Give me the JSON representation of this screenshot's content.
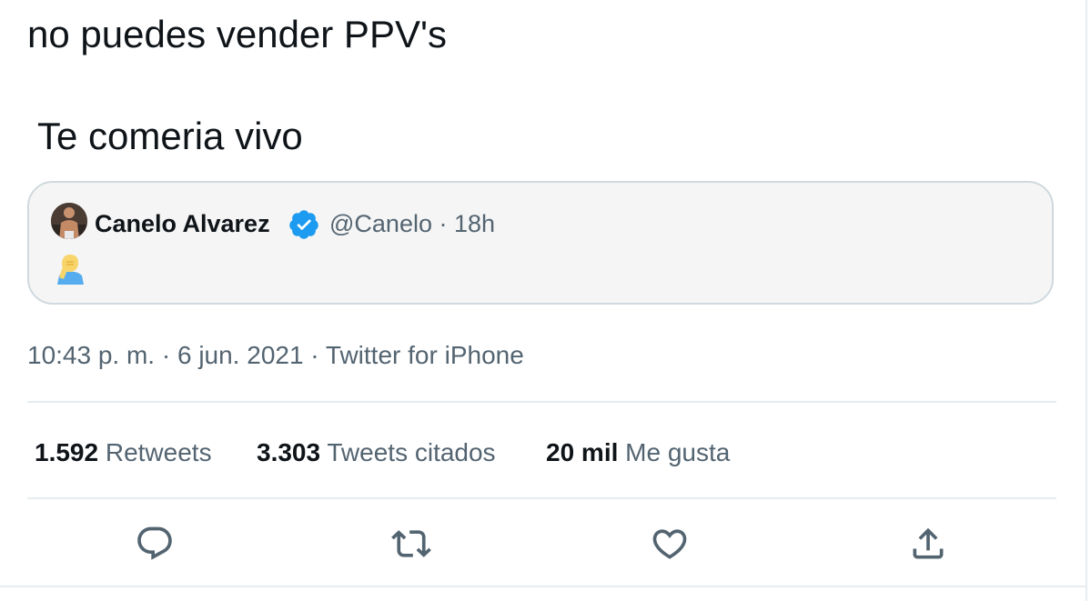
{
  "tweet": {
    "text_line1": "no puedes vender PPV's",
    "text_line2": "Te comeria vivo"
  },
  "quoted_tweet": {
    "name": "Canelo Alvarez",
    "handle_time": "@Canelo · 18h",
    "verified": true,
    "emoji": "face-palm-emoji"
  },
  "meta": {
    "time_date_source": "10:43 p. m. · 6 jun. 2021 · Twitter for iPhone"
  },
  "stats": [
    {
      "value": "1.592",
      "label": "Retweets"
    },
    {
      "value": "3.303",
      "label": "Tweets citados"
    },
    {
      "value": "20 mil",
      "label": "Me gusta"
    }
  ],
  "actions": [
    "reply-icon",
    "retweet-icon",
    "like-icon",
    "share-icon"
  ],
  "colors": {
    "text": "#0f1419",
    "secondary": "#536471",
    "verified": "#1d9bf0",
    "border": "#cfd9de",
    "divider": "#e6ecf0",
    "card_bg": "#f5f5f5"
  }
}
